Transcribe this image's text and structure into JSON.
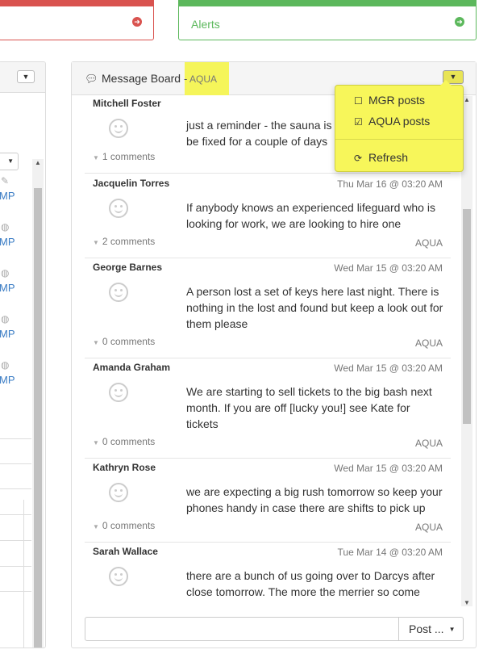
{
  "top_cards": {
    "alerts_title": "Alerts"
  },
  "left_panel": {
    "row_labels": [
      "MP",
      "MP",
      "MP",
      "MP",
      "MP"
    ]
  },
  "board": {
    "title": "Message Board",
    "separator": "-",
    "filter": "AQUA",
    "posts": [
      {
        "author": "Mitchell Foster",
        "date": "",
        "body": "just a reminder - the sauna is\nbe fixed for a couple of days",
        "comments": "1 comments",
        "group": ""
      },
      {
        "author": "Jacquelin Torres",
        "date": "Thu Mar 16 @ 03:20 AM",
        "body": "If anybody knows an experienced lifeguard who is looking for work, we are looking to hire one",
        "comments": "2 comments",
        "group": "AQUA"
      },
      {
        "author": "George Barnes",
        "date": "Wed Mar 15 @ 03:20 AM",
        "body": "A person lost a set of keys here last night. There is nothing in the lost and found but keep a look out for them please",
        "comments": "0 comments",
        "group": "AQUA"
      },
      {
        "author": "Amanda Graham",
        "date": "Wed Mar 15 @ 03:20 AM",
        "body": "We are starting to sell tickets to the big bash next month. If you are off [lucky you!] see Kate for tickets",
        "comments": "0 comments",
        "group": "AQUA"
      },
      {
        "author": "Kathryn Rose",
        "date": "Wed Mar 15 @ 03:20 AM",
        "body": "we are expecting a big rush tomorrow so keep your phones handy in case there are shifts to pick up",
        "comments": "0 comments",
        "group": "AQUA"
      },
      {
        "author": "Sarah Wallace",
        "date": "Tue Mar 14 @ 03:20 AM",
        "body": "there are a bunch of us going over to Darcys after close tomorrow. The more the merrier so come",
        "comments": "",
        "group": ""
      }
    ],
    "composer": {
      "placeholder": "",
      "post_label": "Post ..."
    }
  },
  "dropdown": {
    "items": [
      {
        "label": "MGR posts",
        "checked": false
      },
      {
        "label": "AQUA posts",
        "checked": true
      }
    ],
    "refresh_label": "Refresh"
  },
  "colors": {
    "danger": "#d9534f",
    "success": "#5cb85c",
    "highlight": "#f7f65a",
    "link": "#3a7cc4"
  }
}
